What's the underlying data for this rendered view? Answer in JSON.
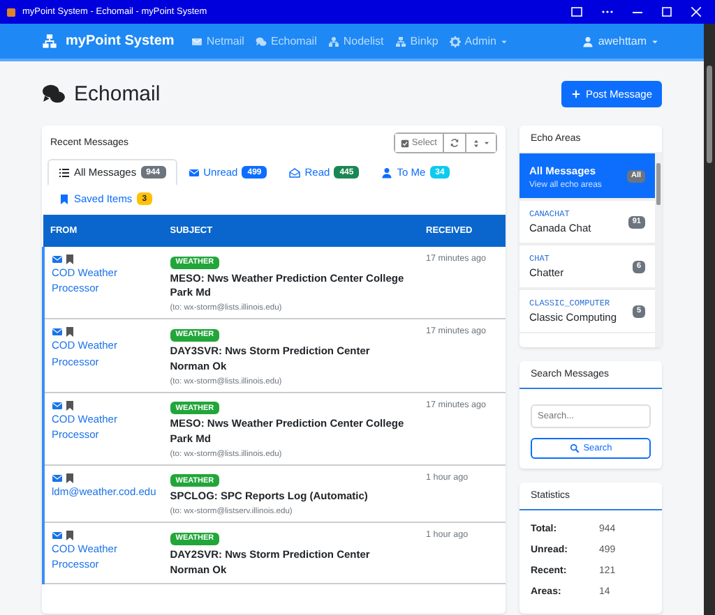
{
  "window": {
    "title": "myPoint System - Echomail - myPoint System"
  },
  "navbar": {
    "brand": "myPoint System",
    "links": [
      {
        "label": "Netmail",
        "kind": "envelope"
      },
      {
        "label": "Echomail",
        "kind": "comments"
      },
      {
        "label": "Nodelist",
        "kind": "sitemap"
      },
      {
        "label": "Binkp",
        "kind": "network"
      },
      {
        "label": "Admin",
        "kind": "gear"
      }
    ],
    "user": "awehttam"
  },
  "page": {
    "title": "Echomail",
    "post_button": "Post Message"
  },
  "messages_card": {
    "title": "Recent Messages",
    "select_button": "Select",
    "tabs": [
      {
        "label": "All Messages",
        "count": "944",
        "color": "#6c757d",
        "kind": "list",
        "selected": true
      },
      {
        "label": "Unread",
        "count": "499",
        "color": "#0d6efd",
        "kind": "envelope",
        "selected": false
      },
      {
        "label": "Read",
        "count": "445",
        "color": "#198754",
        "kind": "envelope-open",
        "selected": false
      },
      {
        "label": "To Me",
        "count": "34",
        "color": "#0dcaf0",
        "kind": "user",
        "selected": false
      },
      {
        "label": "Saved Items",
        "count": "3",
        "color": "#ffc107",
        "kind": "bookmark",
        "selected": false
      }
    ],
    "table": {
      "columns": [
        "FROM",
        "SUBJECT",
        "RECEIVED"
      ],
      "rows": [
        {
          "from": "COD Weather Processor",
          "tag": "WEATHER",
          "subject": "MESO: Nws Weather Prediction Center College Park Md",
          "to": "(to: wx-storm@lists.illinois.edu)",
          "received": "17 minutes ago"
        },
        {
          "from": "COD Weather Processor",
          "tag": "WEATHER",
          "subject": "DAY3SVR: Nws Storm Prediction Center Norman Ok",
          "to": "(to: wx-storm@lists.illinois.edu)",
          "received": "17 minutes ago"
        },
        {
          "from": "COD Weather Processor",
          "tag": "WEATHER",
          "subject": "MESO: Nws Weather Prediction Center College Park Md",
          "to": "(to: wx-storm@lists.illinois.edu)",
          "received": "17 minutes ago"
        },
        {
          "from": "ldm@weather.cod.edu",
          "tag": "WEATHER",
          "subject": "SPCLOG: SPC Reports Log (Automatic)",
          "to": "(to: wx-storm@listserv.illinois.edu)",
          "received": "1 hour ago"
        },
        {
          "from": "COD Weather Processor",
          "tag": "WEATHER",
          "subject": "DAY2SVR: Nws Storm Prediction Center Norman Ok",
          "received": "1 hour ago"
        }
      ]
    }
  },
  "echo_areas": {
    "title": "Echo Areas",
    "items": [
      {
        "name": "All Messages",
        "subtitle": "View all echo areas",
        "count": "All",
        "selected": true
      },
      {
        "tag": "CANACHAT",
        "name": "Canada Chat",
        "count": "91",
        "selected": false
      },
      {
        "tag": "CHAT",
        "name": "Chatter",
        "count": "6",
        "selected": false
      },
      {
        "tag": "CLASSIC_COMPUTER",
        "name": "Classic Computing",
        "count": "5",
        "selected": false
      }
    ]
  },
  "search": {
    "title": "Search Messages",
    "placeholder": "Search...",
    "button": "Search"
  },
  "statistics": {
    "title": "Statistics",
    "rows": [
      {
        "label": "Total:",
        "value": "944"
      },
      {
        "label": "Unread:",
        "value": "499"
      },
      {
        "label": "Recent:",
        "value": "121"
      },
      {
        "label": "Areas:",
        "value": "14"
      }
    ]
  }
}
